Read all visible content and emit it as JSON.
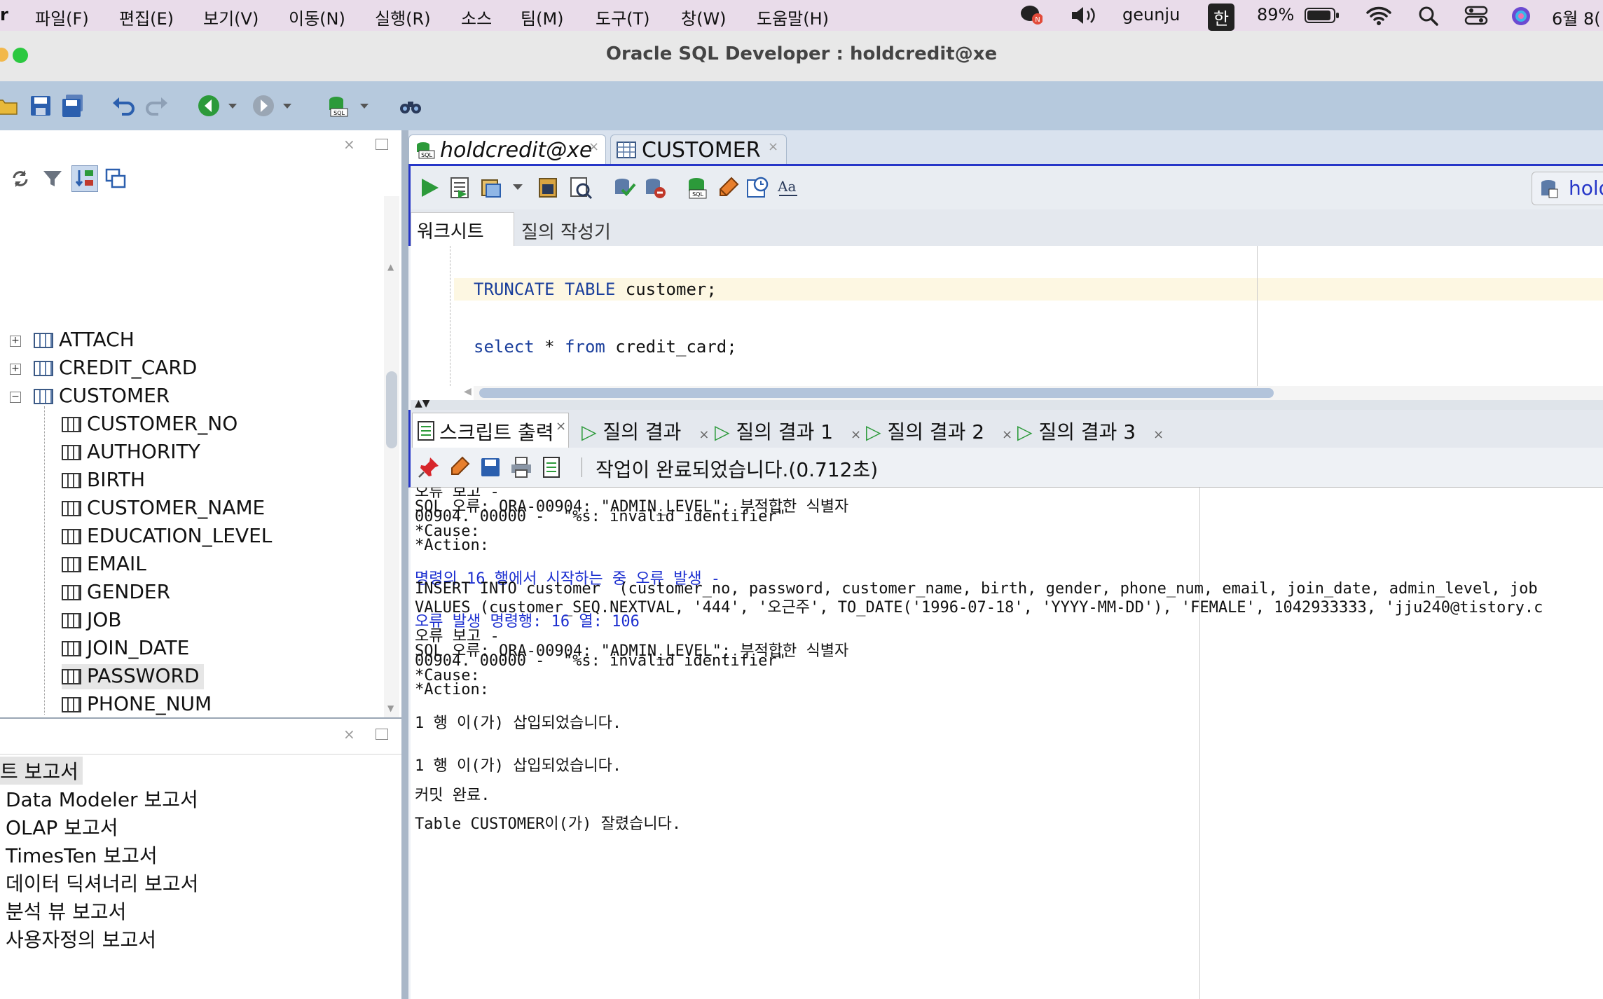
{
  "menubar": {
    "app_fragment": "r",
    "items": [
      "파일(F)",
      "편집(E)",
      "보기(V)",
      "이동(N)",
      "실행(R)",
      "소스",
      "팀(M)",
      "도구(T)",
      "창(W)",
      "도움말(H)"
    ],
    "user": "geunju",
    "input_method": "한",
    "battery": "89%",
    "date": "6월 8("
  },
  "window": {
    "title": "Oracle SQL Developer : holdcredit@xe"
  },
  "tree": {
    "tables": [
      {
        "label": "ATTACH",
        "expanded": false
      },
      {
        "label": "CREDIT_CARD",
        "expanded": false
      },
      {
        "label": "CUSTOMER",
        "expanded": true
      }
    ],
    "columns": [
      "CUSTOMER_NO",
      "AUTHORITY",
      "BIRTH",
      "CUSTOMER_NAME",
      "EDUCATION_LEVEL",
      "EMAIL",
      "GENDER",
      "JOB",
      "JOIN_DATE",
      "PASSWORD",
      "PHONE_NUM"
    ],
    "selected_column": "PASSWORD"
  },
  "reports": {
    "items": [
      "Data Modeler 보고서",
      "OLAP 보고서",
      "TimesTen 보고서",
      "데이터 딕셔너리 보고서",
      "분석 뷰 보고서",
      "사용자정의 보고서"
    ],
    "header": "트 보고서"
  },
  "doc_tabs": [
    {
      "label": "holdcredit@xe",
      "active": true
    },
    {
      "label": "CUSTOMER",
      "active": false
    }
  ],
  "connection_fragment": "hold",
  "sub_tabs": [
    "워크시트",
    "질의 작성기"
  ],
  "editor": {
    "line1": {
      "kw1": "TRUNCATE",
      "kw2": "TABLE",
      "rest": " customer;"
    },
    "line2": {
      "kw1": "select",
      "star": " * ",
      "kw2": "from",
      "rest": " credit_card;"
    }
  },
  "output_tabs": [
    "스크립트 출력",
    "질의 결과",
    "질의 결과 1",
    "질의 결과 2",
    "질의 결과 3"
  ],
  "output_status": "작업이 완료되었습니다.(0.712초)",
  "output_lines": [
    {
      "text": "오류 보고 -",
      "blue": false
    },
    {
      "text": "SQL 오류: ORA-00904: \"ADMIN_LEVEL\": 부적합한 식별자",
      "blue": false
    },
    {
      "text": "00904. 00000 -  \"%s: invalid identifier\"",
      "blue": false
    },
    {
      "text": "*Cause:",
      "blue": false
    },
    {
      "text": "*Action:",
      "blue": false
    },
    {
      "text": "",
      "blue": false
    },
    {
      "text": "명령의 16 행에서 시작하는 중 오류 발생 -",
      "blue": true
    },
    {
      "text": "INSERT INTO customer  (customer_no, password, customer_name, birth, gender, phone_num, email, join_date, admin_level, job",
      "blue": false
    },
    {
      "text": "VALUES (customer_SEQ.NEXTVAL, '444', '오근주', TO_DATE('1996-07-18', 'YYYY-MM-DD'), 'FEMALE', 1042933333, 'jju240@tistory.c",
      "blue": false
    },
    {
      "text": "오류 발생 명령행: 16 열: 106",
      "blue": true
    },
    {
      "text": "오류 보고 -",
      "blue": false
    },
    {
      "text": "SQL 오류: ORA-00904: \"ADMIN_LEVEL\": 부적합한 식별자",
      "blue": false
    },
    {
      "text": "00904. 00000 -  \"%s: invalid identifier\"",
      "blue": false
    },
    {
      "text": "*Cause:",
      "blue": false
    },
    {
      "text": "*Action:",
      "blue": false
    },
    {
      "text": "",
      "blue": false
    },
    {
      "text": "1 행 이(가) 삽입되었습니다.",
      "blue": false
    },
    {
      "text": "",
      "blue": false
    },
    {
      "text": "",
      "blue": false
    },
    {
      "text": "1 행 이(가) 삽입되었습니다.",
      "blue": false
    },
    {
      "text": "",
      "blue": false
    },
    {
      "text": "커밋 완료.",
      "blue": false
    },
    {
      "text": "",
      "blue": false
    },
    {
      "text": "Table CUSTOMER이(가) 잘렸습니다.",
      "blue": false
    }
  ],
  "colors": {
    "accent": "#2636c8",
    "blue_text": "#1c2fd0",
    "keyword": "#1b3f9c",
    "toolbar": "#b6c9dd"
  }
}
